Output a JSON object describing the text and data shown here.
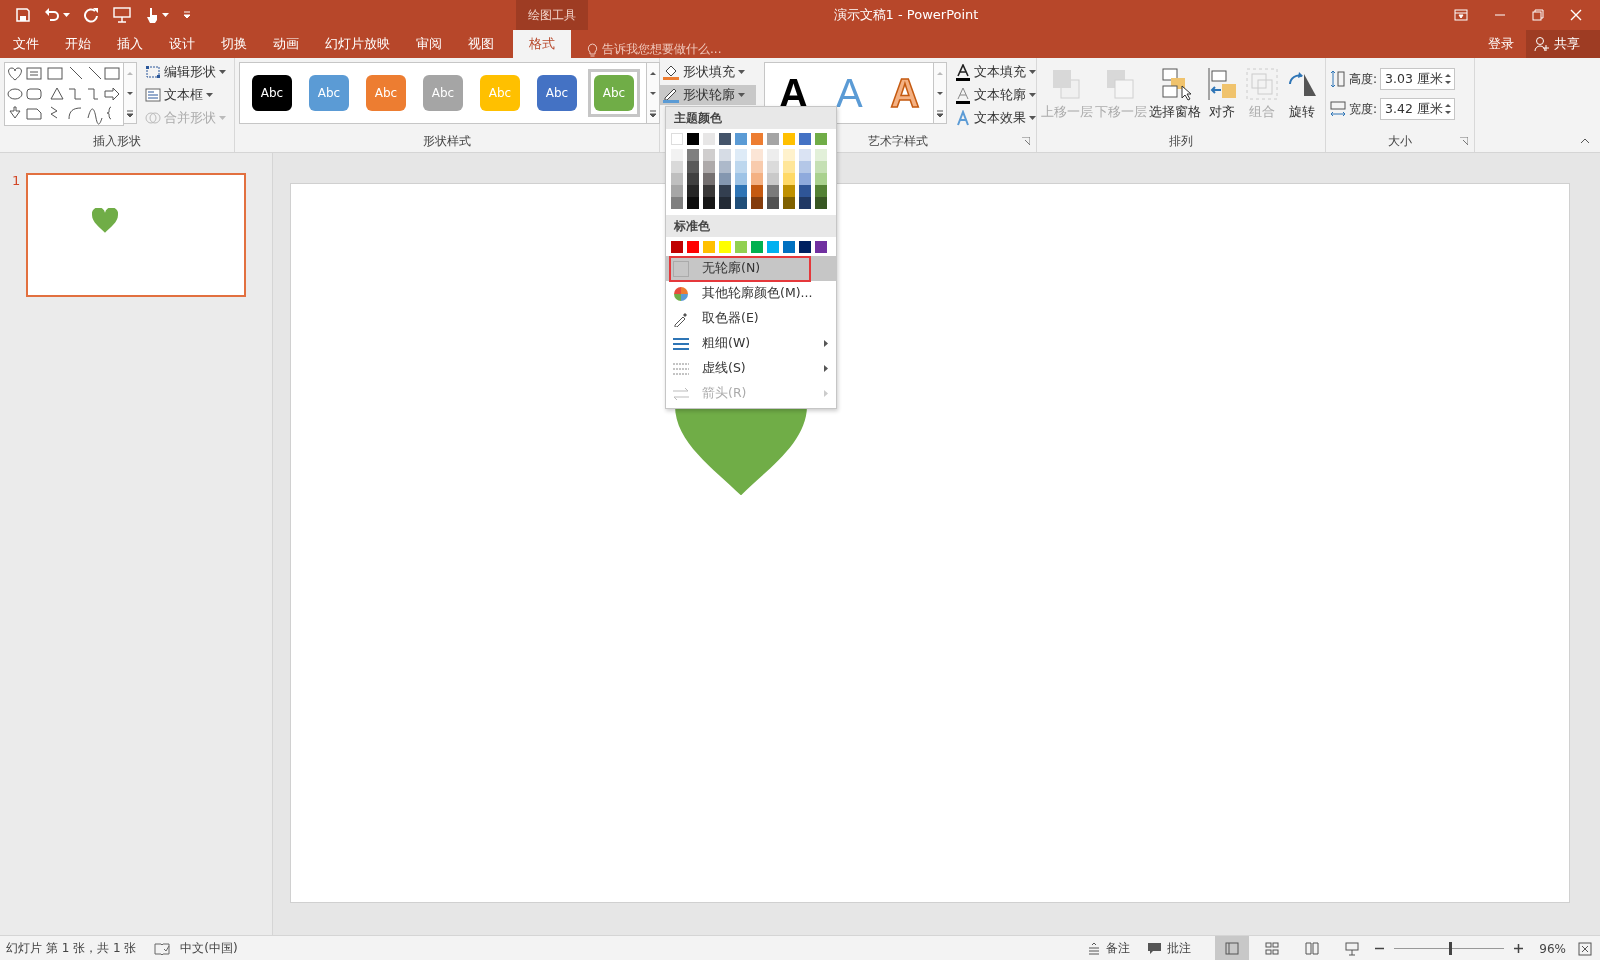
{
  "window": {
    "title": "演示文稿1 - PowerPoint",
    "context_group": "绘图工具"
  },
  "tabs": [
    {
      "label": "文件",
      "selected": false
    },
    {
      "label": "开始",
      "selected": false
    },
    {
      "label": "插入",
      "selected": false
    },
    {
      "label": "设计",
      "selected": false
    },
    {
      "label": "切换",
      "selected": false
    },
    {
      "label": "动画",
      "selected": false
    },
    {
      "label": "幻灯片放映",
      "selected": false
    },
    {
      "label": "审阅",
      "selected": false
    },
    {
      "label": "视图",
      "selected": false
    },
    {
      "label": "格式",
      "selected": true
    }
  ],
  "tell_me": {
    "placeholder": "告诉我您想要做什么..."
  },
  "account": {
    "sign_in": "登录",
    "share": "共享"
  },
  "ribbon": {
    "insert_shapes": {
      "label": "插入形状",
      "commands": [
        {
          "label": "编辑形状",
          "kind": "edit",
          "disabled": false
        },
        {
          "label": "文本框",
          "kind": "textbox",
          "disabled": false
        },
        {
          "label": "合并形状",
          "kind": "merge",
          "disabled": true
        }
      ]
    },
    "shape_styles": {
      "label": "形状样式",
      "swatches": [
        {
          "text": "Abc",
          "color": "#000000",
          "selected": false
        },
        {
          "text": "Abc",
          "color": "#5b9bd5",
          "selected": false
        },
        {
          "text": "Abc",
          "color": "#ed7d31",
          "selected": false
        },
        {
          "text": "Abc",
          "color": "#a5a5a5",
          "selected": false
        },
        {
          "text": "Abc",
          "color": "#ffc000",
          "selected": false
        },
        {
          "text": "Abc",
          "color": "#4472c4",
          "selected": false
        },
        {
          "text": "Abc",
          "color": "#70ad47",
          "selected": true
        }
      ],
      "commands": [
        {
          "label": "形状填充",
          "kind": "fill",
          "pressed": false
        },
        {
          "label": "形状轮廓",
          "kind": "outline",
          "pressed": true
        }
      ]
    },
    "wordart_styles": {
      "label": "艺术字样式",
      "samples": [
        {
          "text": "A",
          "kind": "solid"
        },
        {
          "text": "A",
          "kind": "blue"
        },
        {
          "text": "A",
          "kind": "outline"
        }
      ],
      "commands": [
        {
          "label": "文本填充",
          "kind": "fill"
        },
        {
          "label": "文本轮廓",
          "kind": "outline"
        },
        {
          "label": "文本效果",
          "kind": "effects"
        }
      ]
    },
    "arrange": {
      "label": "排列",
      "buttons": [
        {
          "label": "上移一层",
          "kind": "forward",
          "disabled": true
        },
        {
          "label": "下移一层",
          "kind": "backward",
          "disabled": true
        },
        {
          "label": "选择窗格",
          "kind": "pane",
          "disabled": false
        },
        {
          "label": "对齐",
          "kind": "align",
          "disabled": false
        },
        {
          "label": "组合",
          "kind": "group",
          "disabled": true
        },
        {
          "label": "旋转",
          "kind": "rotate",
          "disabled": false
        }
      ]
    },
    "size": {
      "label": "大小",
      "fields": [
        {
          "label": "高度:",
          "value": "3.03 厘米",
          "kind": "height"
        },
        {
          "label": "宽度:",
          "value": "3.42 厘米",
          "kind": "width"
        }
      ]
    }
  },
  "thumbnails": [
    {
      "number": "1",
      "selected": true
    }
  ],
  "outline_menu": {
    "theme_label": "主题颜色",
    "theme_columns": [
      [
        {
          "color": "#ffffff"
        },
        {
          "color": "#f2f2f2"
        },
        {
          "color": "#d9d9d9"
        },
        {
          "color": "#bfbfbf"
        },
        {
          "color": "#a6a6a6"
        },
        {
          "color": "#808080"
        }
      ],
      [
        {
          "color": "#000000"
        },
        {
          "color": "#7f7f7f"
        },
        {
          "color": "#595959"
        },
        {
          "color": "#404040"
        },
        {
          "color": "#262626"
        },
        {
          "color": "#0d0d0d"
        }
      ],
      [
        {
          "color": "#e7e6e6"
        },
        {
          "color": "#d0cece"
        },
        {
          "color": "#aeaaaa"
        },
        {
          "color": "#757070"
        },
        {
          "color": "#3a3838"
        },
        {
          "color": "#161616"
        }
      ],
      [
        {
          "color": "#44546a"
        },
        {
          "color": "#d6dce5"
        },
        {
          "color": "#adb9ca"
        },
        {
          "color": "#8497b0"
        },
        {
          "color": "#333f50"
        },
        {
          "color": "#222a35"
        }
      ],
      [
        {
          "color": "#5b9bd5"
        },
        {
          "color": "#deebf7"
        },
        {
          "color": "#bdd7ee"
        },
        {
          "color": "#9dc3e6"
        },
        {
          "color": "#2e75b6"
        },
        {
          "color": "#1f4e79"
        }
      ],
      [
        {
          "color": "#ed7d31"
        },
        {
          "color": "#fbe5d6"
        },
        {
          "color": "#f8cbad"
        },
        {
          "color": "#f4b183"
        },
        {
          "color": "#c55a11"
        },
        {
          "color": "#843c0c"
        }
      ],
      [
        {
          "color": "#a5a5a5"
        },
        {
          "color": "#ededed"
        },
        {
          "color": "#dbdbdb"
        },
        {
          "color": "#c9c9c9"
        },
        {
          "color": "#7b7b7b"
        },
        {
          "color": "#525252"
        }
      ],
      [
        {
          "color": "#ffc000"
        },
        {
          "color": "#fff2cc"
        },
        {
          "color": "#ffe699"
        },
        {
          "color": "#ffd966"
        },
        {
          "color": "#bf9000"
        },
        {
          "color": "#7f6000"
        }
      ],
      [
        {
          "color": "#4472c4"
        },
        {
          "color": "#dae3f3"
        },
        {
          "color": "#b4c7e7"
        },
        {
          "color": "#8faadc"
        },
        {
          "color": "#2f5597"
        },
        {
          "color": "#203864"
        }
      ],
      [
        {
          "color": "#70ad47"
        },
        {
          "color": "#e2f0d9"
        },
        {
          "color": "#c5e0b4"
        },
        {
          "color": "#a9d18e"
        },
        {
          "color": "#548235"
        },
        {
          "color": "#385723"
        }
      ]
    ],
    "standard_label": "标准色",
    "standard_colors": [
      {
        "color": "#c00000"
      },
      {
        "color": "#ff0000"
      },
      {
        "color": "#ffc000"
      },
      {
        "color": "#ffff00"
      },
      {
        "color": "#92d050"
      },
      {
        "color": "#00b050"
      },
      {
        "color": "#00b0f0"
      },
      {
        "color": "#0070c0"
      },
      {
        "color": "#002060"
      },
      {
        "color": "#7030a0"
      }
    ],
    "items": [
      {
        "label": "无轮廓(N)",
        "kind": "none",
        "highlighted": true,
        "submenu": false,
        "disabled": false
      },
      {
        "label": "其他轮廓颜色(M)...",
        "kind": "more",
        "highlighted": false,
        "submenu": false,
        "disabled": false
      },
      {
        "label": "取色器(E)",
        "kind": "eyedropper",
        "highlighted": false,
        "submenu": false,
        "disabled": false
      },
      {
        "label": "粗细(W)",
        "kind": "weight",
        "highlighted": false,
        "submenu": true,
        "disabled": false
      },
      {
        "label": "虚线(S)",
        "kind": "dash",
        "highlighted": false,
        "submenu": true,
        "disabled": false
      },
      {
        "label": "箭头(R)",
        "kind": "arrows",
        "highlighted": false,
        "submenu": true,
        "disabled": true
      }
    ]
  },
  "status_bar": {
    "slide_info": "幻灯片 第 1 张，共 1 张",
    "language": "中文(中国)",
    "notes": "备注",
    "comments": "批注",
    "views": [
      {
        "kind": "normal",
        "selected": true
      },
      {
        "kind": "sorter",
        "selected": false
      },
      {
        "kind": "reading",
        "selected": false
      },
      {
        "kind": "show",
        "selected": false
      }
    ],
    "zoom": {
      "level": 0.5,
      "reading": "96%"
    }
  }
}
